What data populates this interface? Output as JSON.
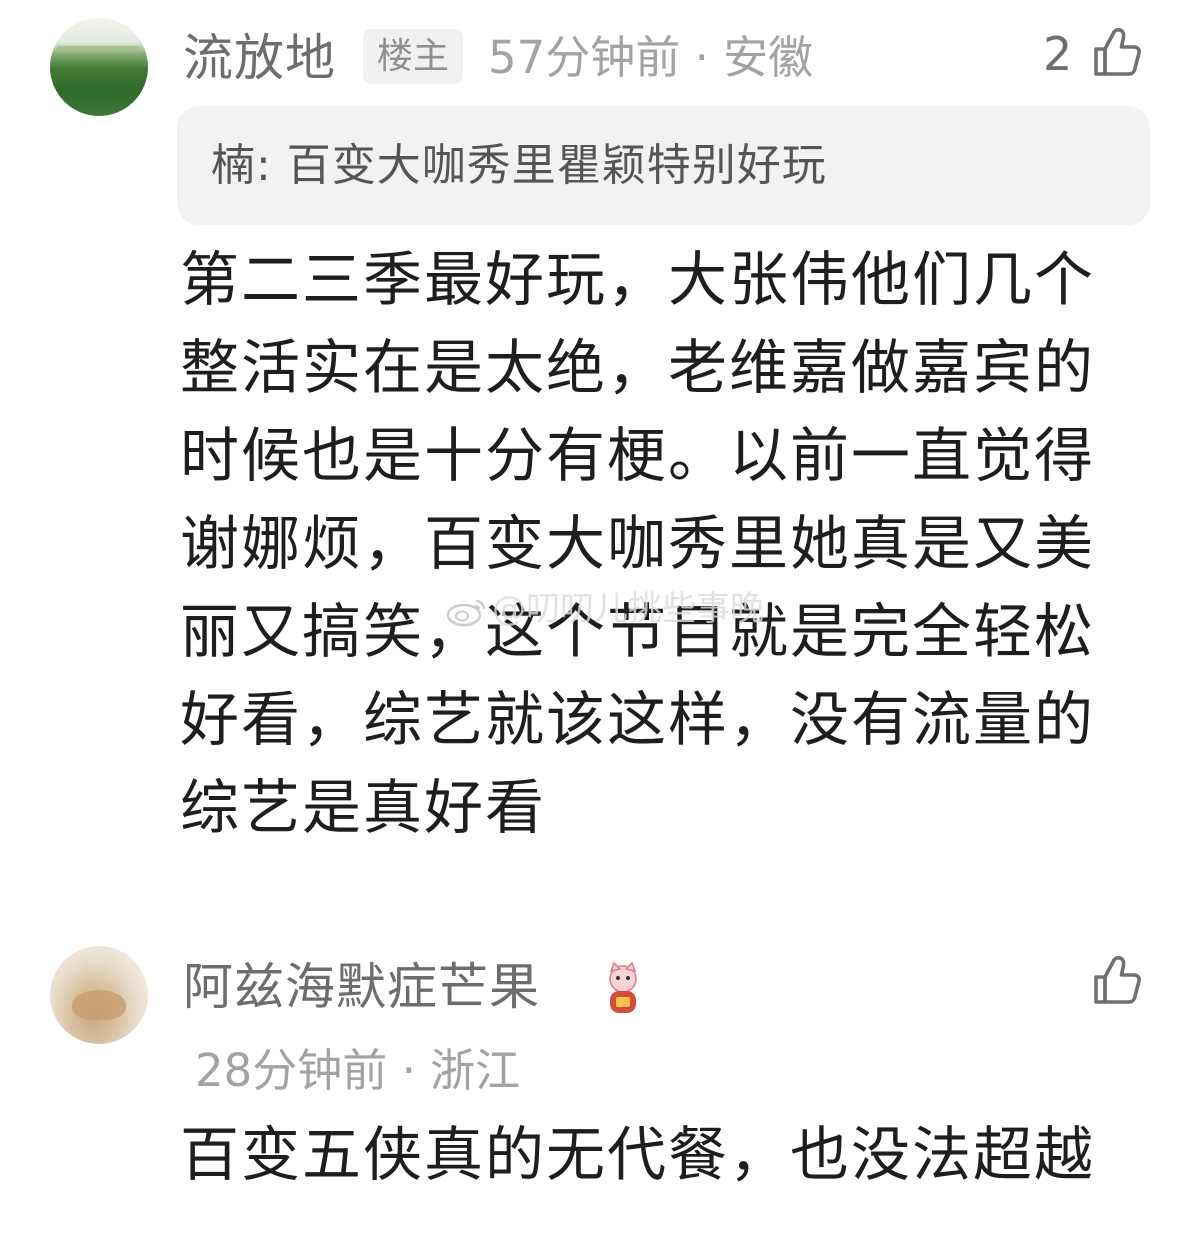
{
  "comments": [
    {
      "username": "流放地",
      "op_badge": "楼主",
      "meta": "57分钟前 · 安徽",
      "likes": "2",
      "reply_quote": "楠: 百变大咖秀里瞿颖特别好玩",
      "content": "第二三季最好玩，大张伟他们几个整活实在是太绝，老维嘉做嘉宾的时候也是十分有梗。以前一直觉得谢娜烦，百变大咖秀里她真是又美丽又搞笑，这个节目就是完全轻松好看，综艺就该这样，没有流量的综艺是真好看"
    },
    {
      "username": "阿兹海默症芒果",
      "meta": "28分钟前 · 浙江",
      "content": "百变五侠真的无代餐，也没法超越"
    }
  ],
  "watermark": {
    "text": "@叨叨儿挑些事晚"
  },
  "icons": {
    "like": "thumbs-up-icon",
    "badge": "lucky-cat-emoji-icon",
    "watermark_logo": "weibo-logo-icon"
  },
  "colors": {
    "username": "#6d6d6d",
    "meta": "#a3a3a3",
    "content": "#1e1e1e",
    "quote_bg": "#f2f2f2"
  }
}
